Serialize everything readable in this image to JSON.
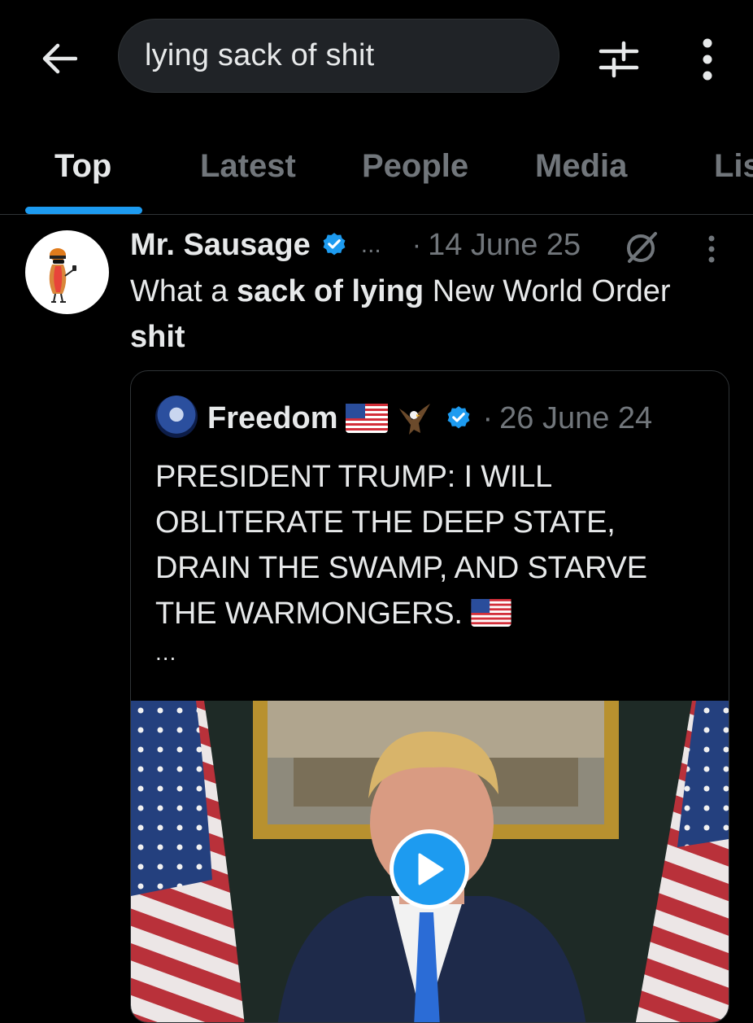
{
  "search": {
    "query": "lying sack of shit"
  },
  "tabs": [
    "Top",
    "Latest",
    "People",
    "Media",
    "Lis"
  ],
  "tweet": {
    "author": "Mr. Sausage",
    "name_more": "...",
    "dot": "·",
    "date": "14 June 25",
    "text": {
      "p1": "What a ",
      "b1": "sack of lying",
      "p2": " New World Order ",
      "b2": "shit"
    }
  },
  "quote": {
    "author": "Freedom",
    "dot": "·",
    "date": "26 June 24",
    "text": "PRESIDENT TRUMP: I WILL OBLITERATE THE DEEP STATE, DRAIN THE SWAMP, AND STARVE THE WARMONGERS.",
    "more": "..."
  },
  "icons": {
    "back": "arrow-left-icon",
    "filter": "sliders-icon",
    "more": "more-vertical-icon",
    "verified": "verified-badge-icon",
    "grok": "grok-icon",
    "play": "play-icon"
  },
  "colors": {
    "accent": "#1d9bf0",
    "muted": "#71767b",
    "text": "#e7e9ea",
    "background": "#000000"
  }
}
